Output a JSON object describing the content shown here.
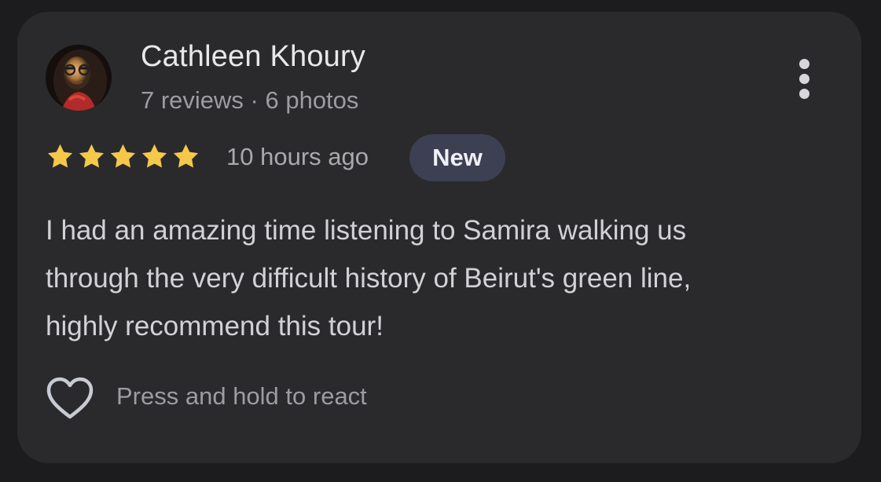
{
  "review": {
    "author_name": "Cathleen Khoury",
    "author_meta": "7 reviews · 6 photos",
    "rating": 5,
    "rating_max": 5,
    "time_ago": "10 hours ago",
    "badge": "New",
    "text_lines": [
      "I had an amazing time listening to Samira walking us",
      "through the very difficult history of Beirut's green line,",
      "highly recommend this tour!"
    ],
    "react_hint": "Press and hold to react"
  },
  "icons": {
    "avatar": "user-avatar-photo",
    "more": "more-vert-icon",
    "star": "star-icon",
    "react": "heart-outline-icon"
  },
  "colors": {
    "background": "#1c1c1e",
    "card": "#2a2a2c",
    "star": "#f5c84a",
    "badge_bg": "#3d3f52",
    "primary_text": "#e8e8ea",
    "secondary_text": "#9c9ca2"
  }
}
